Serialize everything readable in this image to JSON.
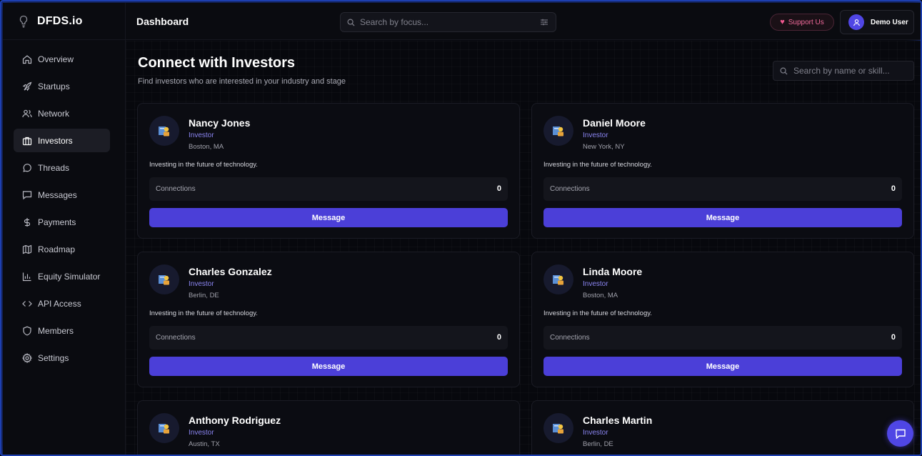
{
  "app": {
    "brand": "DFDS.io"
  },
  "sidebar": {
    "items": [
      {
        "label": "Overview",
        "icon": "home-icon"
      },
      {
        "label": "Startups",
        "icon": "rocket-icon"
      },
      {
        "label": "Network",
        "icon": "users-icon"
      },
      {
        "label": "Investors",
        "icon": "briefcase-icon",
        "active": true
      },
      {
        "label": "Threads",
        "icon": "chat-bubble-icon"
      },
      {
        "label": "Messages",
        "icon": "message-square-icon"
      },
      {
        "label": "Payments",
        "icon": "dollar-icon"
      },
      {
        "label": "Roadmap",
        "icon": "map-icon"
      },
      {
        "label": "Equity Simulator",
        "icon": "bar-chart-icon"
      },
      {
        "label": "API Access",
        "icon": "code-icon"
      },
      {
        "label": "Members",
        "icon": "shield-icon"
      },
      {
        "label": "Settings",
        "icon": "gear-icon"
      }
    ]
  },
  "header": {
    "title": "Dashboard",
    "search_placeholder": "Search by focus...",
    "support_label": "Support Us",
    "user_name": "Demo User"
  },
  "main": {
    "title": "Connect with Investors",
    "subtitle": "Find investors who are interested in your industry and stage",
    "search_placeholder": "Search by name or skill..."
  },
  "investors": [
    {
      "name": "Nancy Jones",
      "role": "Investor",
      "location": "Boston, MA",
      "bio": "Investing in the future of technology.",
      "connections_label": "Connections",
      "connections": "0",
      "button": "Message"
    },
    {
      "name": "Daniel Moore",
      "role": "Investor",
      "location": "New York, NY",
      "bio": "Investing in the future of technology.",
      "connections_label": "Connections",
      "connections": "0",
      "button": "Message"
    },
    {
      "name": "Charles Gonzalez",
      "role": "Investor",
      "location": "Berlin, DE",
      "bio": "Investing in the future of technology.",
      "connections_label": "Connections",
      "connections": "0",
      "button": "Message"
    },
    {
      "name": "Linda Moore",
      "role": "Investor",
      "location": "Boston, MA",
      "bio": "Investing in the future of technology.",
      "connections_label": "Connections",
      "connections": "0",
      "button": "Message"
    },
    {
      "name": "Anthony Rodriguez",
      "role": "Investor",
      "location": "Austin, TX"
    },
    {
      "name": "Charles Martin",
      "role": "Investor",
      "location": "Berlin, DE"
    }
  ],
  "colors": {
    "accent": "#4b3fd8",
    "role_text": "#8a84f0",
    "support_pink": "#f06a9a",
    "frame_glow": "#1d3fb0"
  }
}
